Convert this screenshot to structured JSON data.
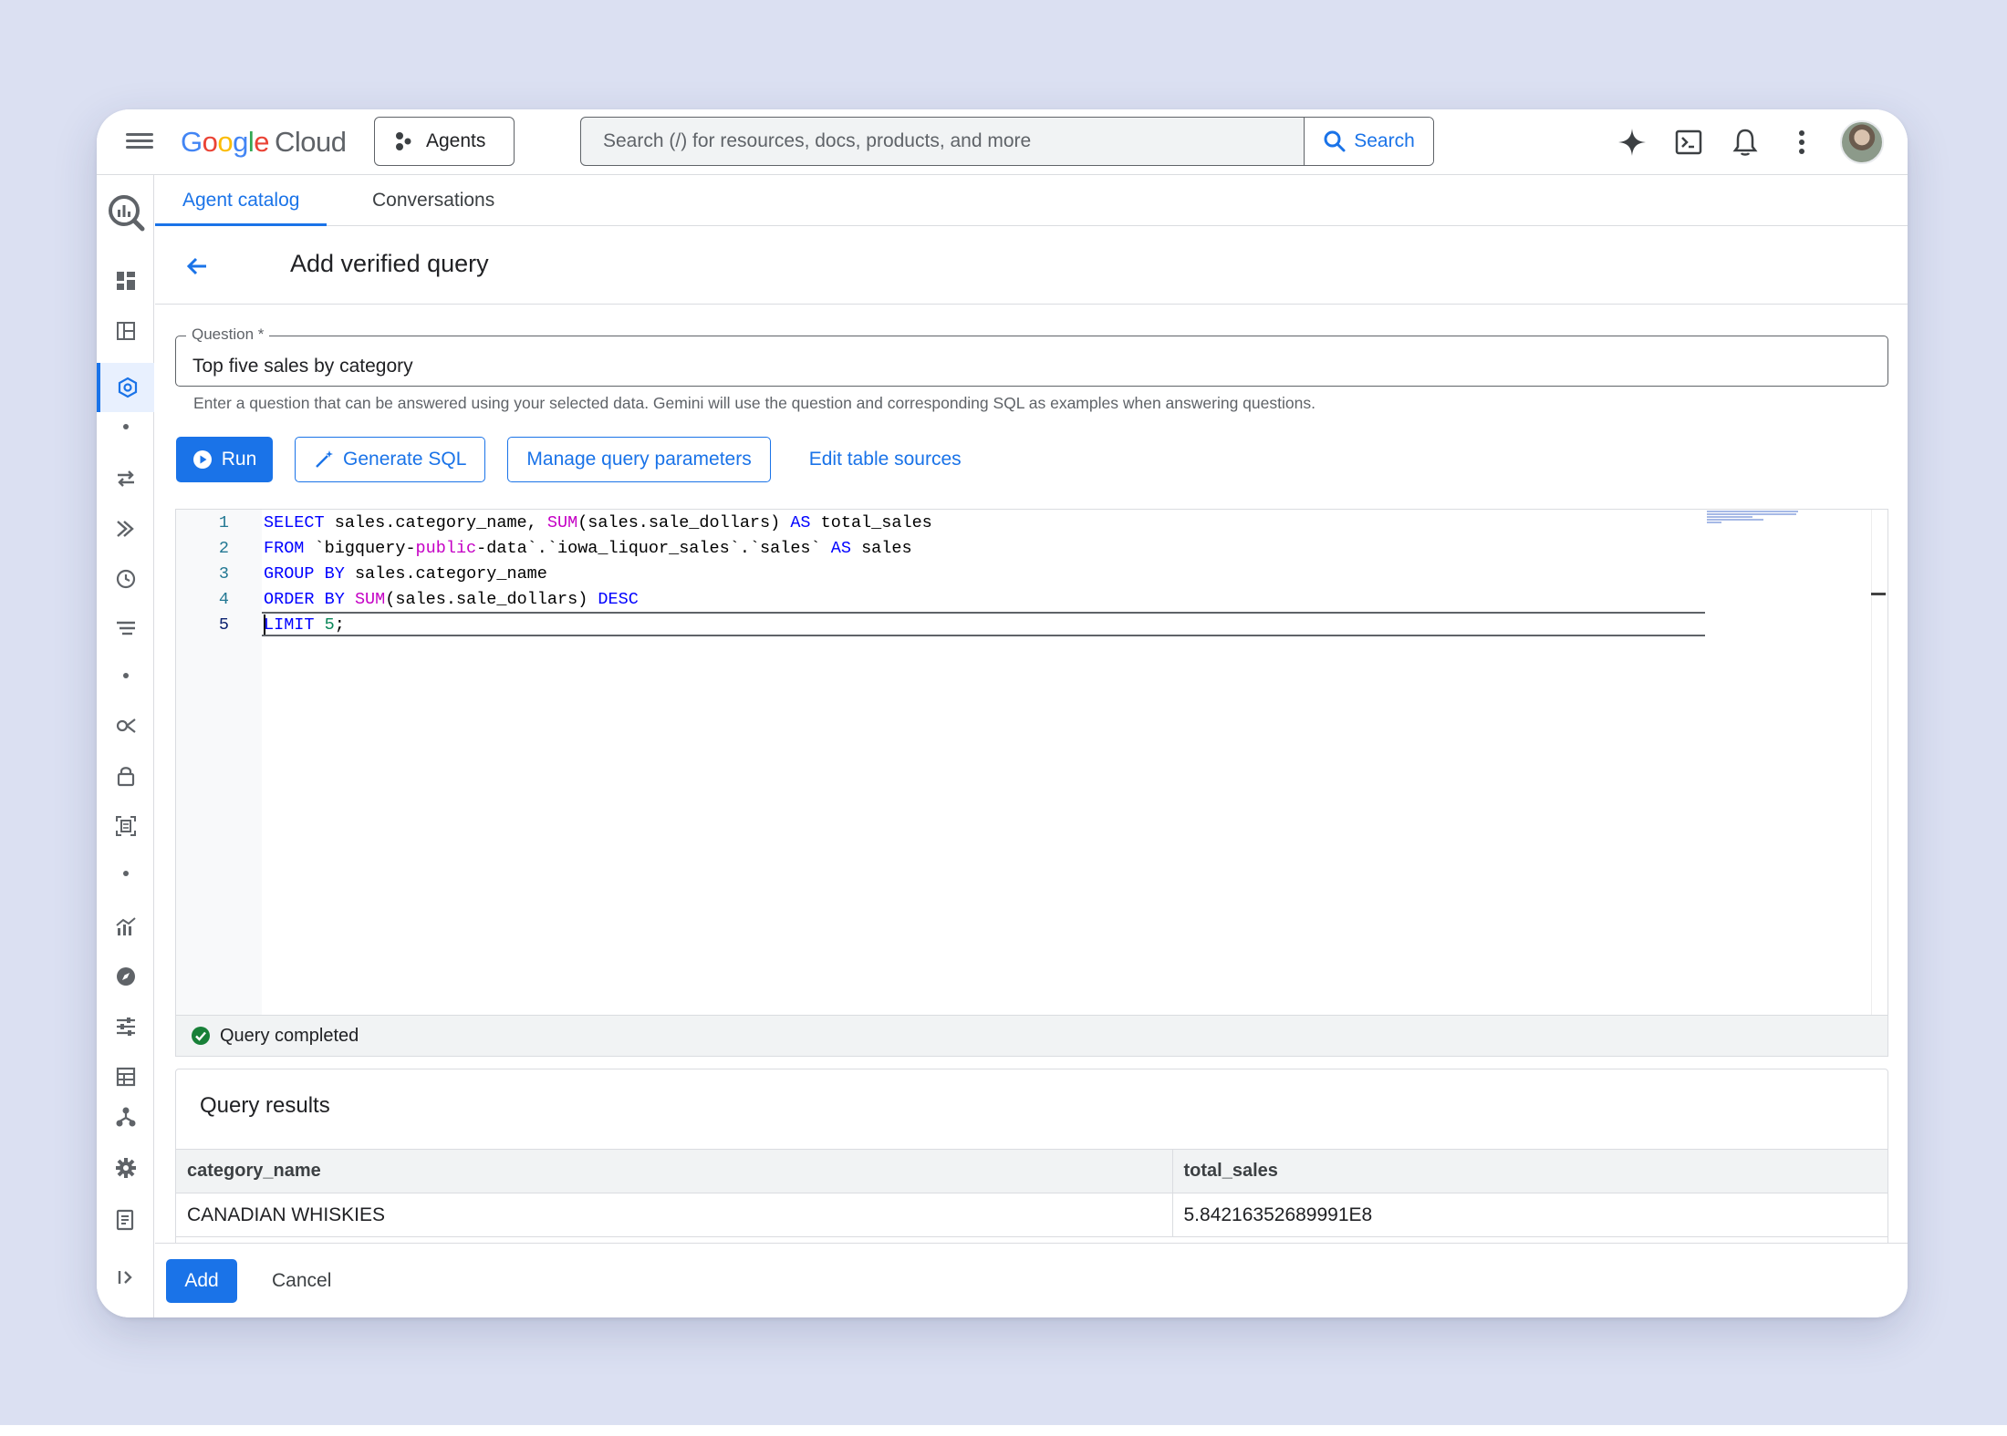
{
  "topbar": {
    "logo_google": [
      "G",
      "o",
      "o",
      "g",
      "l",
      "e"
    ],
    "logo_cloud": "Cloud",
    "agents_label": "Agents",
    "search_placeholder": "Search (/) for resources, docs, products, and more",
    "search_button": "Search"
  },
  "tabs": [
    {
      "label": "Agent catalog",
      "active": true
    },
    {
      "label": "Conversations",
      "active": false
    }
  ],
  "page": {
    "title": "Add verified query"
  },
  "question": {
    "label": "Question *",
    "value": "Top five sales by category",
    "hint": "Enter a question that can be answered using your selected data. Gemini will use the question and corresponding SQL as examples when answering questions."
  },
  "actions": {
    "run": "Run",
    "generate_sql": "Generate SQL",
    "manage_params": "Manage query parameters",
    "edit_sources": "Edit table sources"
  },
  "editor": {
    "line_numbers": [
      "1",
      "2",
      "3",
      "4",
      "5"
    ],
    "lines": [
      "SELECT sales.category_name, SUM(sales.sale_dollars) AS total_sales",
      "FROM `bigquery-public-data`.`iowa_liquor_sales`.`sales` AS sales",
      "GROUP BY sales.category_name",
      "ORDER BY SUM(sales.sale_dollars) DESC",
      "LIMIT 5;"
    ]
  },
  "status": {
    "text": "Query completed",
    "color": "#188038"
  },
  "results": {
    "title": "Query results",
    "columns": [
      "category_name",
      "total_sales"
    ],
    "rows": [
      [
        "CANADIAN WHISKIES",
        "5.84216352689991E8"
      ]
    ]
  },
  "footer": {
    "add": "Add",
    "cancel": "Cancel"
  },
  "colors": {
    "accent": "#1a73e8",
    "background": "#dbe0f2"
  }
}
